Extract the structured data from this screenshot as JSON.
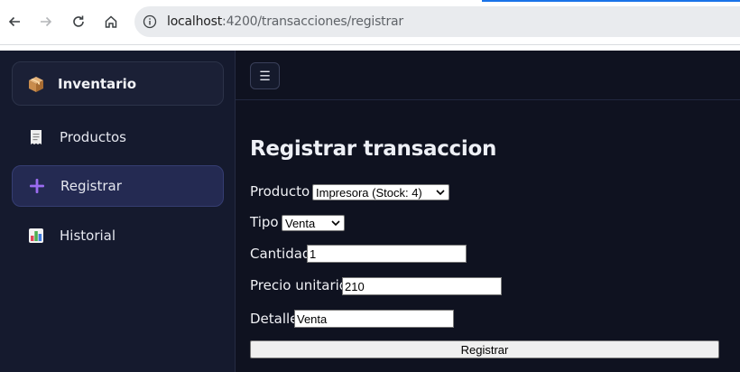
{
  "browser": {
    "url_host": "localhost",
    "url_path": ":4200/transacciones/registrar"
  },
  "sidebar": {
    "brand": {
      "label": "Inventario",
      "icon": "package-icon"
    },
    "items": [
      {
        "label": "Productos",
        "icon": "receipt-icon",
        "active": false
      },
      {
        "label": "Registrar",
        "icon": "plus-icon",
        "active": true
      },
      {
        "label": "Historial",
        "icon": "bar-chart-icon",
        "active": false
      }
    ]
  },
  "topbar": {
    "menu_glyph": "☰"
  },
  "form": {
    "title": "Registrar transaccion",
    "producto": {
      "label": "Producto",
      "value": "Impresora (Stock: 4)"
    },
    "tipo": {
      "label": "Tipo",
      "value": "Venta"
    },
    "cantidad": {
      "label": "Cantidad",
      "value": "1"
    },
    "precio": {
      "label": "Precio unitario",
      "value": "210"
    },
    "detalle": {
      "label": "Detalle",
      "value": "Venta"
    },
    "submit_label": "Registrar"
  },
  "colors": {
    "sidebar_bg": "#151a2e",
    "main_bg": "#0f1220",
    "active_item_bg": "#242a52",
    "plus_accent": "#9b6cf0"
  }
}
